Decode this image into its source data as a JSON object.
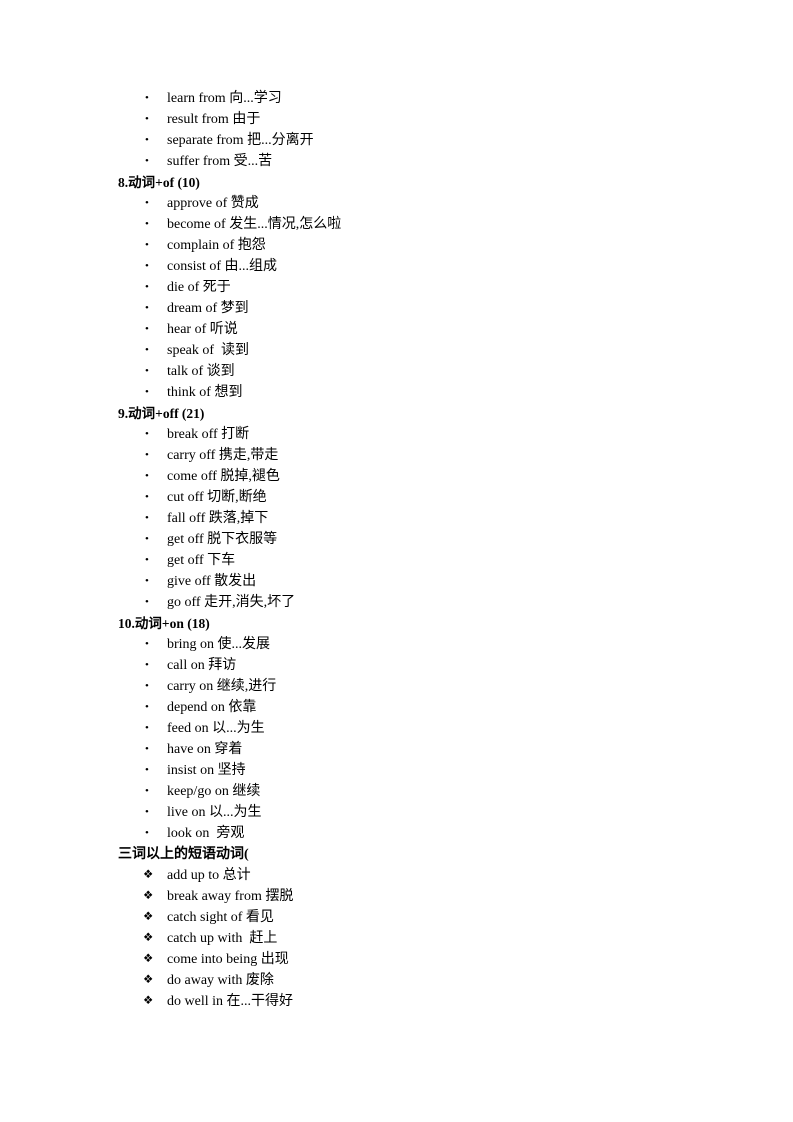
{
  "document": {
    "sections": [
      {
        "id": "from-tail",
        "heading": null,
        "bullet": "dot",
        "items": [
          "learn from 向...学习",
          "result from 由于",
          "separate from 把...分离开",
          "suffer from 受...苦"
        ]
      },
      {
        "id": "verb-of",
        "heading": "8.动词+of (10)",
        "heading_style": "latin",
        "bullet": "dot",
        "items": [
          "approve of 赞成",
          "become of 发生...情况,怎么啦",
          "complain of 抱怨",
          "consist of 由...组成",
          "die of 死于",
          "dream of 梦到",
          "hear of 听说",
          "speak of  读到",
          "talk of 谈到",
          "think of 想到"
        ]
      },
      {
        "id": "verb-off",
        "heading": "9.动词+off (21)",
        "heading_style": "latin",
        "bullet": "dot",
        "items": [
          "break off 打断",
          "carry off 携走,带走",
          "come off 脱掉,褪色",
          "cut off 切断,断绝",
          "fall off 跌落,掉下",
          "get off 脱下衣服等",
          "get off 下车",
          "give off 散发出",
          "go off 走开,消失,坏了"
        ]
      },
      {
        "id": "verb-on",
        "heading": "10.动词+on (18)",
        "heading_style": "latin",
        "bullet": "dot",
        "items": [
          "bring on 使...发展",
          "call on 拜访",
          "carry on 继续,进行",
          "depend on 依靠",
          "feed on 以...为生",
          "have on 穿着",
          "insist on 坚持",
          "keep/go on 继续",
          "live on 以...为生",
          "look on  旁观"
        ]
      },
      {
        "id": "multi-word-phrasal",
        "heading": "三词以上的短语动词(",
        "heading_style": "cn",
        "bullet": "diamond",
        "items": [
          "add up to 总计",
          "break away from 摆脱",
          "catch sight of 看见",
          "catch up with  赶上",
          "come into being 出现",
          "do away with 废除",
          "do well in 在...干得好"
        ]
      }
    ],
    "bullets": {
      "dot": "•",
      "diamond": "❖"
    }
  }
}
